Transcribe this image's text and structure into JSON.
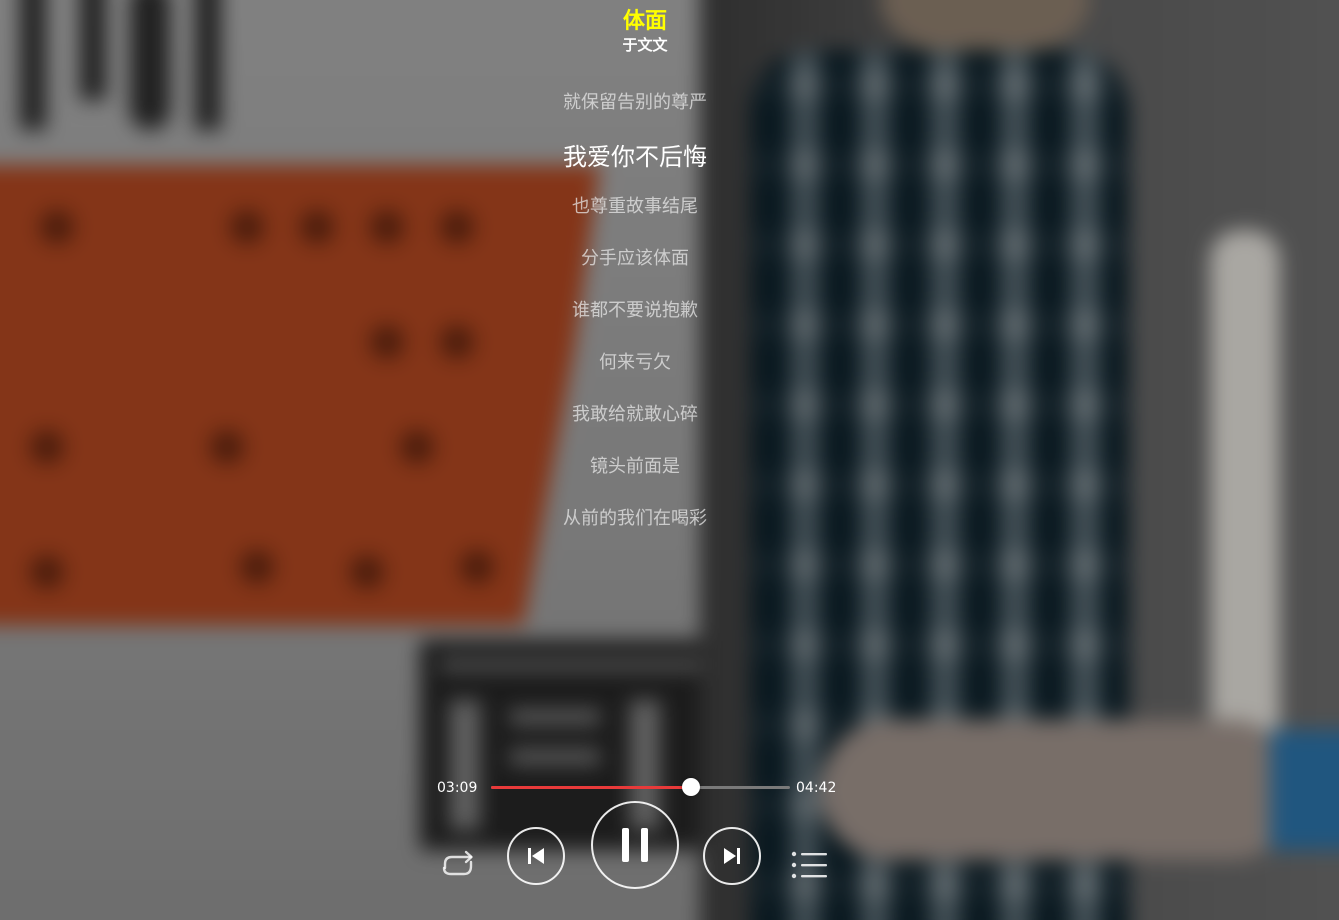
{
  "song": {
    "title": "体面",
    "artist": "于文文"
  },
  "lyrics": [
    {
      "text": "就保留告别的尊严",
      "active": false
    },
    {
      "text": "我爱你不后悔",
      "active": true
    },
    {
      "text": "也尊重故事结尾",
      "active": false
    },
    {
      "text": "分手应该体面",
      "active": false
    },
    {
      "text": "谁都不要说抱歉",
      "active": false
    },
    {
      "text": "何来亏欠",
      "active": false
    },
    {
      "text": "我敢给就敢心碎",
      "active": false
    },
    {
      "text": "镜头前面是",
      "active": false
    },
    {
      "text": "从前的我们在喝彩",
      "active": false
    }
  ],
  "playback": {
    "current_time": "03:09",
    "total_time": "04:42",
    "progress_fraction": 0.67,
    "state": "playing"
  },
  "controls": {
    "repeat": {
      "icon": "repeat-icon"
    },
    "previous": {
      "icon": "skip-previous-icon"
    },
    "play_pause": {
      "icon": "pause-icon"
    },
    "next": {
      "icon": "skip-next-icon"
    },
    "playlist": {
      "icon": "playlist-icon"
    }
  },
  "colors": {
    "title": "#ffff00",
    "progress_played": "#e83a3a",
    "progress_track": "#7a7a7a",
    "lyric_active": "#ffffff"
  }
}
